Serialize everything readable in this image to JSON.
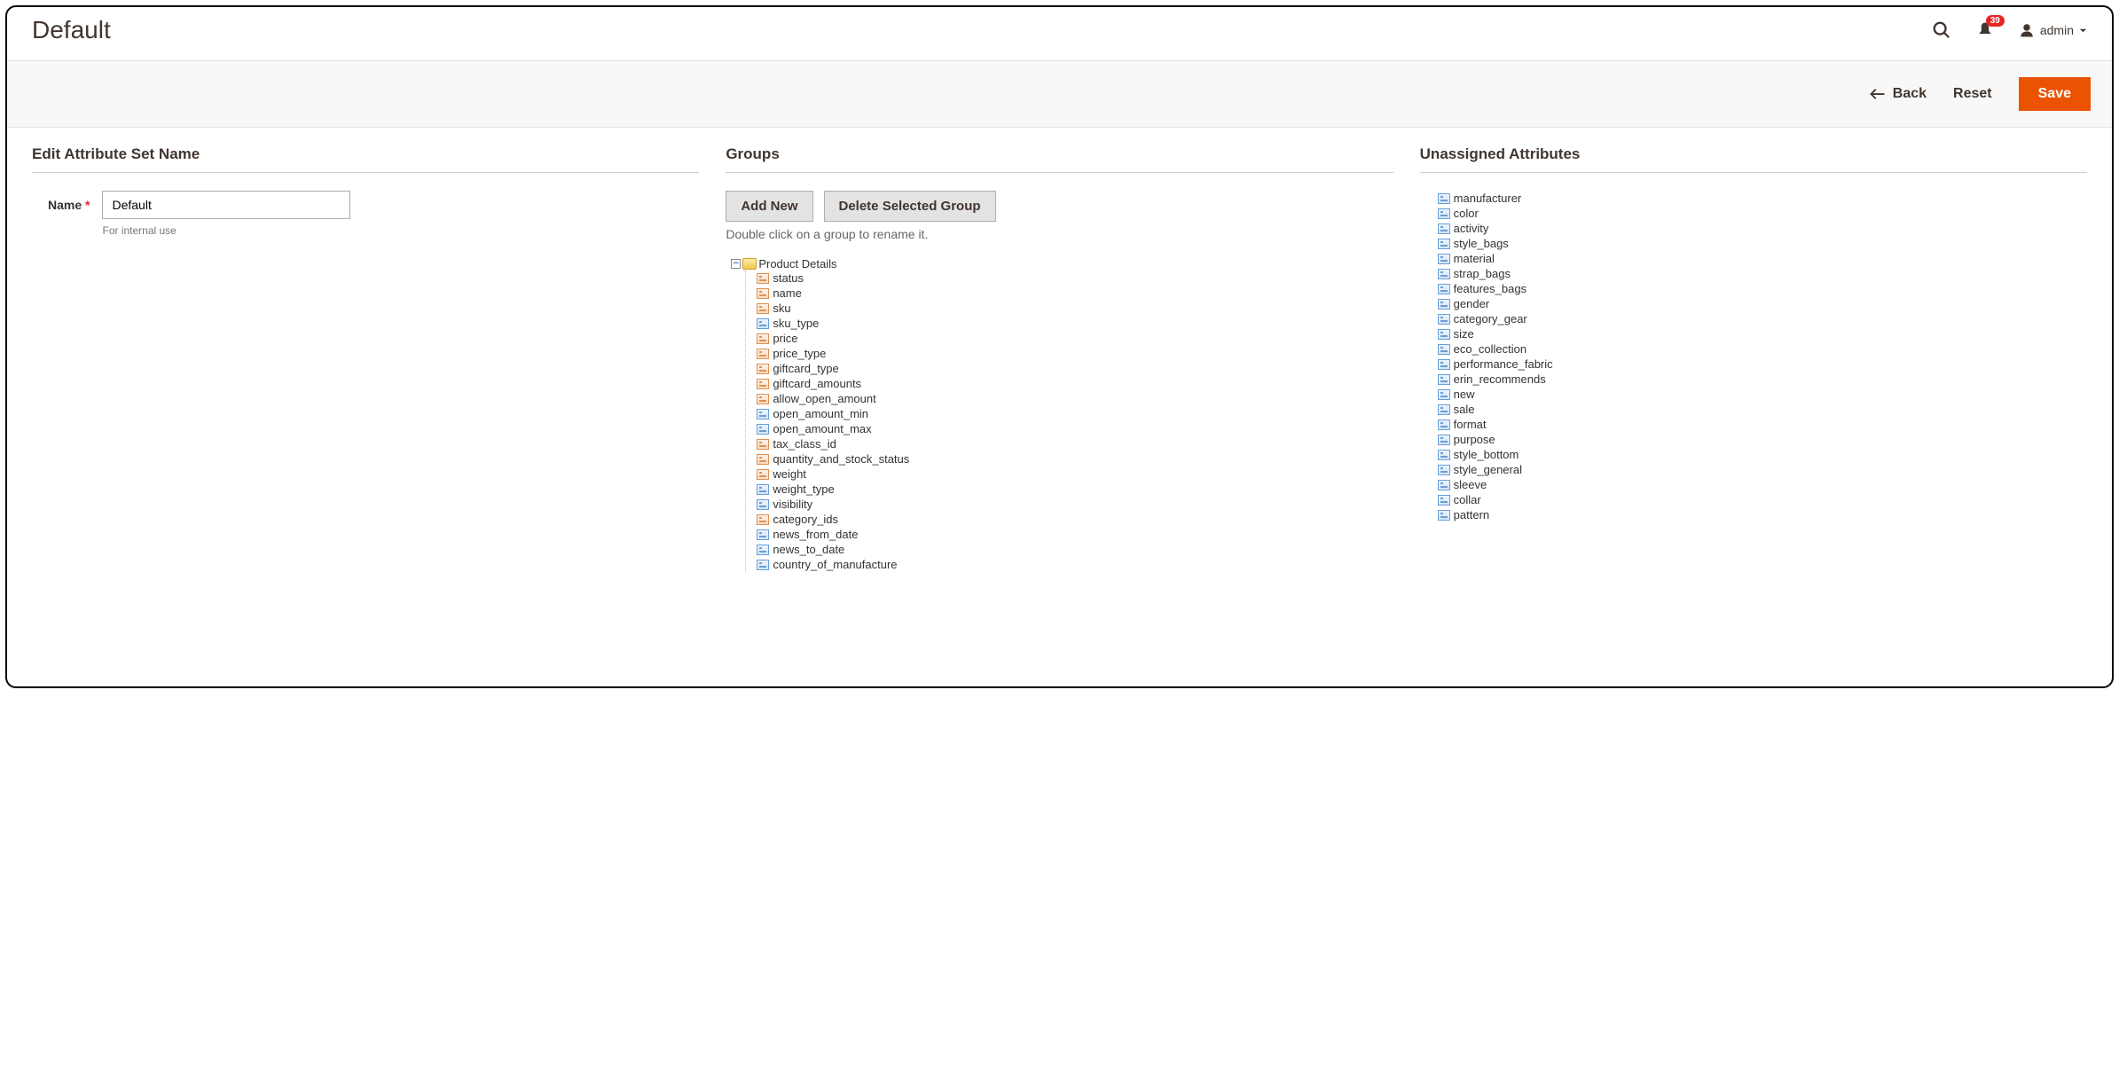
{
  "header": {
    "title": "Default",
    "notification_count": "39",
    "user_label": "admin"
  },
  "actions": {
    "back": "Back",
    "reset": "Reset",
    "save": "Save"
  },
  "edit_section": {
    "title": "Edit Attribute Set Name",
    "name_label": "Name",
    "name_value": "Default",
    "name_hint": "For internal use"
  },
  "groups_section": {
    "title": "Groups",
    "add_new": "Add New",
    "delete_selected": "Delete Selected Group",
    "hint": "Double click on a group to rename it.",
    "group_name": "Product Details",
    "attributes": [
      {
        "name": "status",
        "locked": true
      },
      {
        "name": "name",
        "locked": true
      },
      {
        "name": "sku",
        "locked": true
      },
      {
        "name": "sku_type",
        "locked": false
      },
      {
        "name": "price",
        "locked": true
      },
      {
        "name": "price_type",
        "locked": true
      },
      {
        "name": "giftcard_type",
        "locked": true
      },
      {
        "name": "giftcard_amounts",
        "locked": true
      },
      {
        "name": "allow_open_amount",
        "locked": true
      },
      {
        "name": "open_amount_min",
        "locked": false
      },
      {
        "name": "open_amount_max",
        "locked": false
      },
      {
        "name": "tax_class_id",
        "locked": true
      },
      {
        "name": "quantity_and_stock_status",
        "locked": true
      },
      {
        "name": "weight",
        "locked": true
      },
      {
        "name": "weight_type",
        "locked": false
      },
      {
        "name": "visibility",
        "locked": false
      },
      {
        "name": "category_ids",
        "locked": true
      },
      {
        "name": "news_from_date",
        "locked": false
      },
      {
        "name": "news_to_date",
        "locked": false
      },
      {
        "name": "country_of_manufacture",
        "locked": false
      }
    ]
  },
  "unassigned_section": {
    "title": "Unassigned Attributes",
    "attributes": [
      "manufacturer",
      "color",
      "activity",
      "style_bags",
      "material",
      "strap_bags",
      "features_bags",
      "gender",
      "category_gear",
      "size",
      "eco_collection",
      "performance_fabric",
      "erin_recommends",
      "new",
      "sale",
      "format",
      "purpose",
      "style_bottom",
      "style_general",
      "sleeve",
      "collar",
      "pattern"
    ]
  }
}
